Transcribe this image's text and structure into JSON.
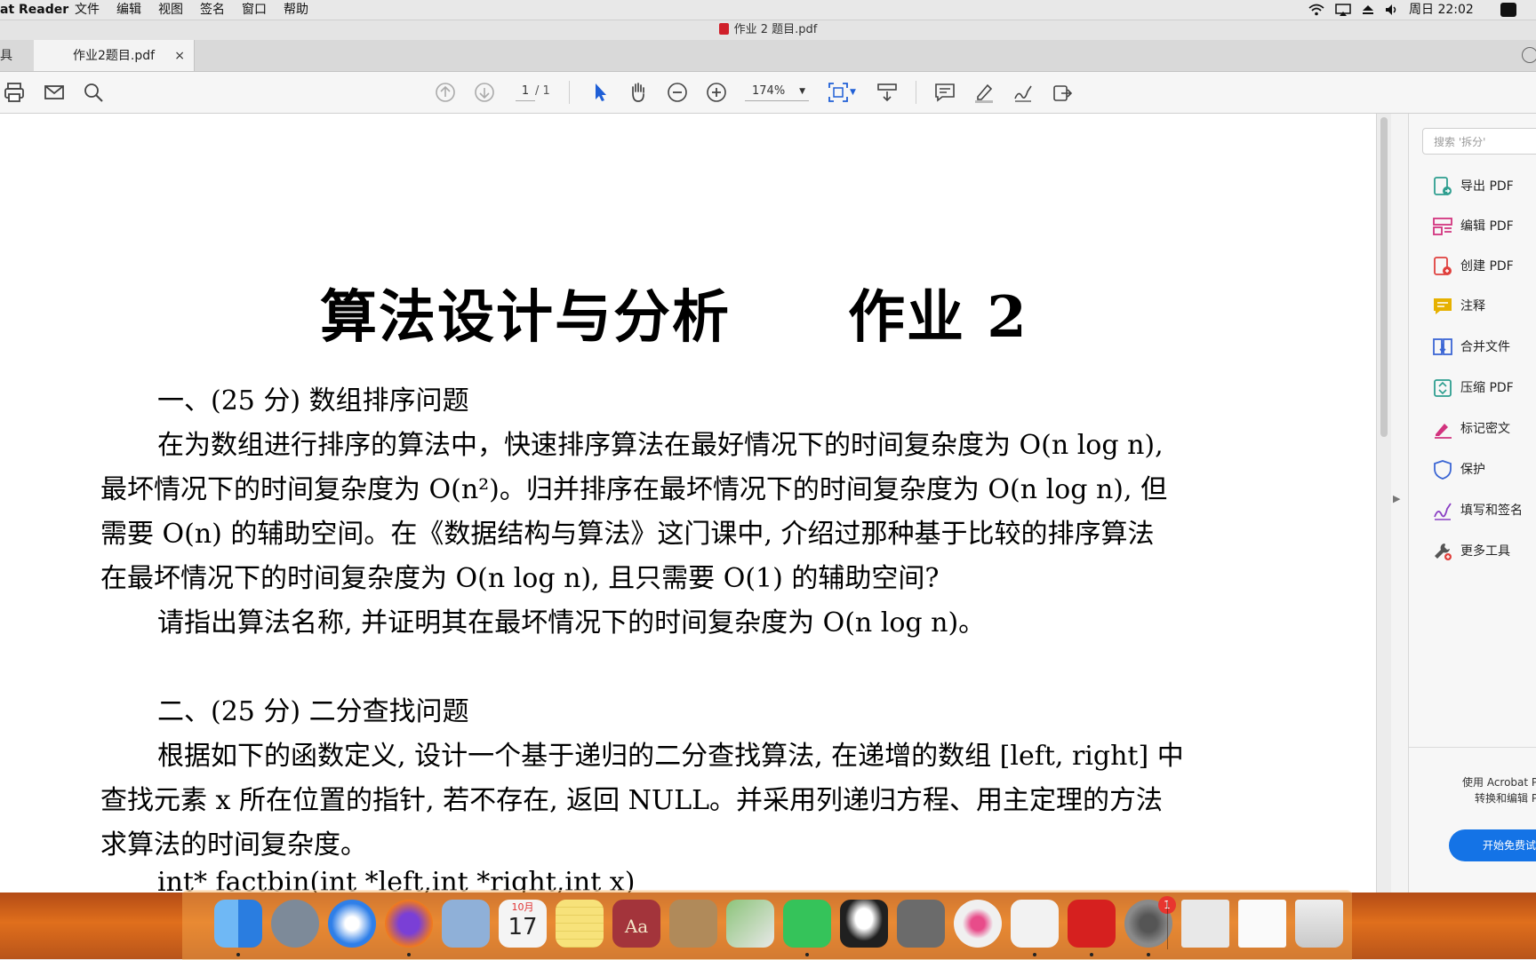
{
  "menubar": {
    "app_name": "at Reader",
    "items": [
      "文件",
      "编辑",
      "视图",
      "签名",
      "窗口",
      "帮助"
    ],
    "clock": "周日 22:02"
  },
  "window": {
    "title": "作业 2 题目.pdf"
  },
  "tabbar": {
    "partial_label": "具",
    "tab_label": "作业2题目.pdf",
    "close_glyph": "×"
  },
  "toolbar": {
    "page_current": "1",
    "page_total": "/ 1",
    "zoom": "174%"
  },
  "right_pane": {
    "search_placeholder": "搜索 '拆分'",
    "tools": [
      {
        "label": "导出 PDF",
        "icon": "export-pdf-icon",
        "color": "#2e9e8f"
      },
      {
        "label": "编辑 PDF",
        "icon": "edit-pdf-icon",
        "color": "#d2347f"
      },
      {
        "label": "创建 PDF",
        "icon": "create-pdf-icon",
        "color": "#e0403d"
      },
      {
        "label": "注释",
        "icon": "comment-icon",
        "color": "#e6b100"
      },
      {
        "label": "合并文件",
        "icon": "combine-files-icon",
        "color": "#3b66d4"
      },
      {
        "label": "压缩 PDF",
        "icon": "compress-pdf-icon",
        "color": "#2e9e8f"
      },
      {
        "label": "标记密文",
        "icon": "redact-icon",
        "color": "#d2347f"
      },
      {
        "label": "保护",
        "icon": "protect-icon",
        "color": "#3b66d4"
      },
      {
        "label": "填写和签名",
        "icon": "fill-sign-icon",
        "color": "#8a3fc4"
      },
      {
        "label": "更多工具",
        "icon": "more-tools-icon",
        "color": "#555555"
      }
    ],
    "promo_line1": "使用 Acrobat P",
    "promo_line2": "转换和编辑 P",
    "promo_button": "开始免费试"
  },
  "document": {
    "title": "算法设计与分析　　作业 2",
    "lines": [
      "一、(25 分) 数组排序问题",
      "在为数组进行排序的算法中，快速排序算法在最好情况下的时间复杂度为 O(n log n),",
      "最坏情况下的时间复杂度为 O(n²)。归并排序在最坏情况下的时间复杂度为 O(n log n), 但",
      "需要 O(n) 的辅助空间。在《数据结构与算法》这门课中, 介绍过那种基于比较的排序算法",
      "在最坏情况下的时间复杂度为 O(n log n), 且只需要 O(1) 的辅助空间?",
      "请指出算法名称, 并证明其在最坏情况下的时间复杂度为 O(n log n)。",
      "二、(25 分) 二分查找问题",
      "根据如下的函数定义, 设计一个基于递归的二分查找算法, 在递增的数组 [left, right] 中",
      "查找元素 x 所在位置的指针, 若不存在, 返回 NULL。并采用列递归方程、用主定理的方法",
      "求算法的时间复杂度。",
      "int* factbin(int *left,int *right,int x)"
    ]
  },
  "dock": {
    "apps": [
      {
        "name": "finder",
        "color": "#3d8ff0"
      },
      {
        "name": "launchpad",
        "color": "#7d8a99"
      },
      {
        "name": "safari",
        "color": "#2f7fe8"
      },
      {
        "name": "firefox",
        "color": "#f27a1a"
      },
      {
        "name": "mail-eagle",
        "color": "#8fb0d8"
      },
      {
        "name": "calendar",
        "color": "#f4f4f4"
      },
      {
        "name": "notes",
        "color": "#f7e27a"
      },
      {
        "name": "dictionary",
        "color": "#a3343b"
      },
      {
        "name": "contacts",
        "color": "#b08a5a"
      },
      {
        "name": "maps",
        "color": "#8cc47a"
      },
      {
        "name": "wechat",
        "color": "#35c35a"
      },
      {
        "name": "qq",
        "color": "#202020"
      },
      {
        "name": "calculator",
        "color": "#6b6b6b"
      },
      {
        "name": "itunes",
        "color": "#f0f0f0"
      },
      {
        "name": "textedit",
        "color": "#f2f2f2"
      },
      {
        "name": "acrobat",
        "color": "#d6201f"
      },
      {
        "name": "system-preferences",
        "color": "#8a8a8a"
      },
      {
        "name": "preview-doc",
        "color": "#e8e8e8"
      },
      {
        "name": "blank-doc",
        "color": "#fafafa"
      },
      {
        "name": "trash",
        "color": "#d9d9d9"
      }
    ],
    "calendar_month": "10月",
    "calendar_day": "17",
    "badge_count": "1",
    "dictionary_label": "Aa"
  }
}
